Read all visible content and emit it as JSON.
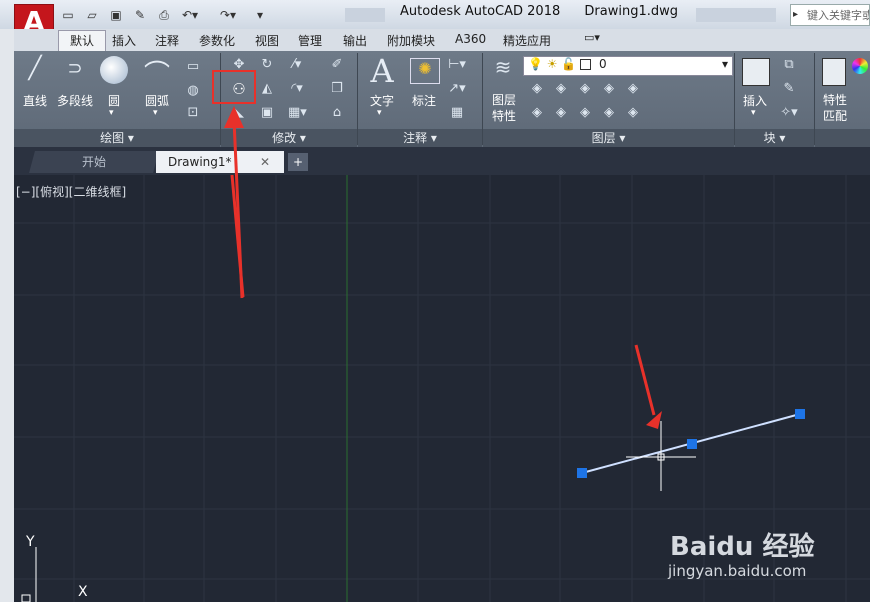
{
  "titlebar": {
    "app_letter": "A",
    "title": "Autodesk AutoCAD 2018",
    "filename": "Drawing1.dwg",
    "search_placeholder": "键入关键字或"
  },
  "ribbon_tabs": [
    "默认",
    "插入",
    "注释",
    "参数化",
    "视图",
    "管理",
    "输出",
    "附加模块",
    "A360",
    "精选应用"
  ],
  "draw_panel": {
    "line": "直线",
    "polyline": "多段线",
    "circle": "圆",
    "arc": "圆弧",
    "title": "绘图 ▾"
  },
  "modify_panel": {
    "title": "修改 ▾"
  },
  "annotation_panel": {
    "text": "文字",
    "dimension": "标注",
    "title": "注释 ▾"
  },
  "layers_panel": {
    "layer_properties": "图层\n特性",
    "layer_value": "0",
    "title": "图层 ▾"
  },
  "block_panel": {
    "insert": "插入",
    "title": "块 ▾"
  },
  "properties_panel": {
    "match": "特性\n匹配"
  },
  "doc_tabs": {
    "start": "开始",
    "drawing": "Drawing1*",
    "add": "+"
  },
  "viewport_label": "[−][俯视][二维线框]",
  "axis": {
    "y": "Y",
    "x": "X"
  },
  "watermark": {
    "brand": "Baidu 经验",
    "url": "jingyan.baidu.com"
  },
  "colors": {
    "highlight_box": "#e8312a",
    "grip": "#1e74e6",
    "line": "#cfe0ff"
  }
}
